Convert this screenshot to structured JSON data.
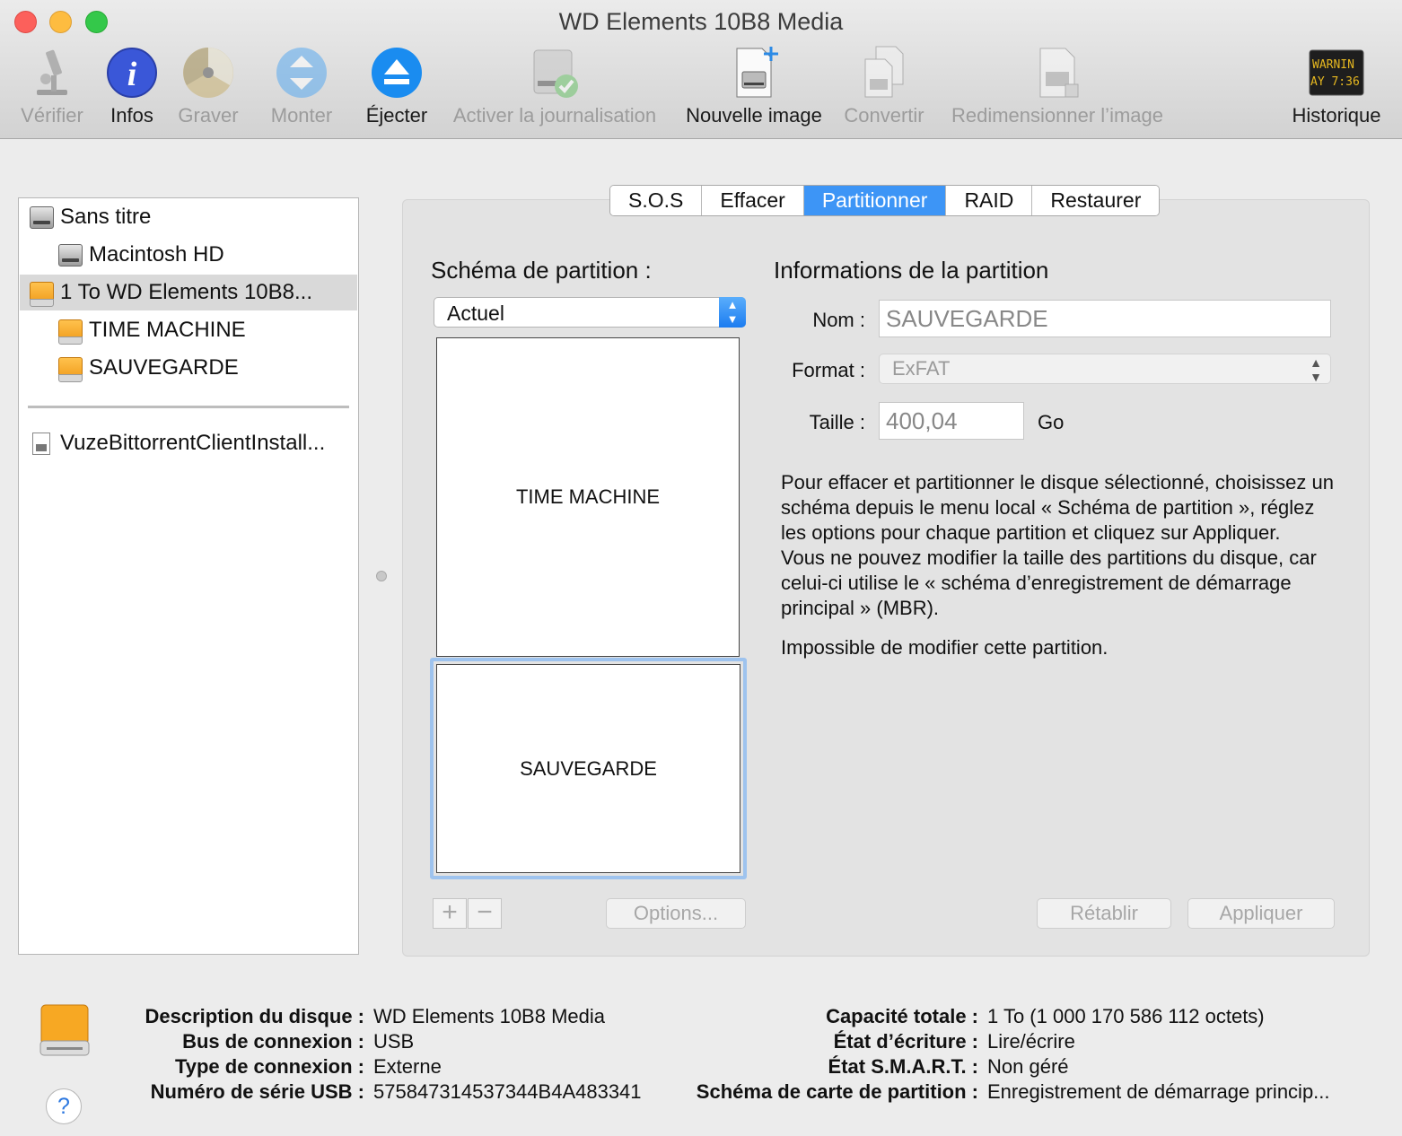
{
  "window": {
    "title": "WD Elements 10B8 Media"
  },
  "toolbar": {
    "verify": "Vérifier",
    "info": "Infos",
    "burn": "Graver",
    "mount": "Monter",
    "eject": "Éjecter",
    "journal": "Activer la journalisation",
    "new_image": "Nouvelle image",
    "convert": "Convertir",
    "resize": "Redimensionner l’image",
    "history": "Historique",
    "history_icon_text": [
      "WARNIN",
      "AY 7:36"
    ]
  },
  "sidebar": {
    "items": [
      {
        "label": "Sans titre"
      },
      {
        "label": "Macintosh HD"
      },
      {
        "label": "1 To WD Elements 10B8..."
      },
      {
        "label": "TIME MACHINE"
      },
      {
        "label": "SAUVEGARDE"
      },
      {
        "label": "VuzeBittorrentClientInstall..."
      }
    ]
  },
  "tabs": [
    "S.O.S",
    "Effacer",
    "Partitionner",
    "RAID",
    "Restaurer"
  ],
  "partition": {
    "scheme_heading": "Schéma de partition :",
    "scheme_value": "Actuel",
    "partitions": [
      "TIME MACHINE",
      "SAUVEGARDE"
    ],
    "info_heading": "Informations de la partition",
    "name_label": "Nom :",
    "name_value": "SAUVEGARDE",
    "format_label": "Format :",
    "format_value": "ExFAT",
    "size_label": "Taille :",
    "size_value": "400,04",
    "size_unit": "Go",
    "help_p1": "Pour effacer et partitionner le disque sélectionné, choisissez un schéma depuis le menu local « Schéma de partition », réglez les options pour chaque partition et cliquez sur Appliquer.",
    "help_p2": "Vous ne pouvez modifier la taille des partitions du disque, car celui-ci utilise le « schéma d’enregistrement de démarrage principal » (MBR).",
    "help_p3": "Impossible de modifier cette partition.",
    "add": "+",
    "remove": "−",
    "options": "Options...",
    "revert": "Rétablir",
    "apply": "Appliquer"
  },
  "disk_info": {
    "description_label": "Description du disque :",
    "description_value": "WD Elements 10B8 Media",
    "bus_label": "Bus de connexion :",
    "bus_value": "USB",
    "type_label": "Type de connexion :",
    "type_value": "Externe",
    "serial_label": "Numéro de série USB :",
    "serial_value": "575847314537344B4A483341",
    "capacity_label": "Capacité totale :",
    "capacity_value": "1 To (1 000 170 586 112 octets)",
    "write_label": "État d’écriture :",
    "write_value": "Lire/écrire",
    "smart_label": "État S.M.A.R.T. :",
    "smart_value": "Non géré",
    "map_label": "Schéma de carte de partition :",
    "map_value": "Enregistrement de démarrage princip..."
  },
  "help_button": "?"
}
